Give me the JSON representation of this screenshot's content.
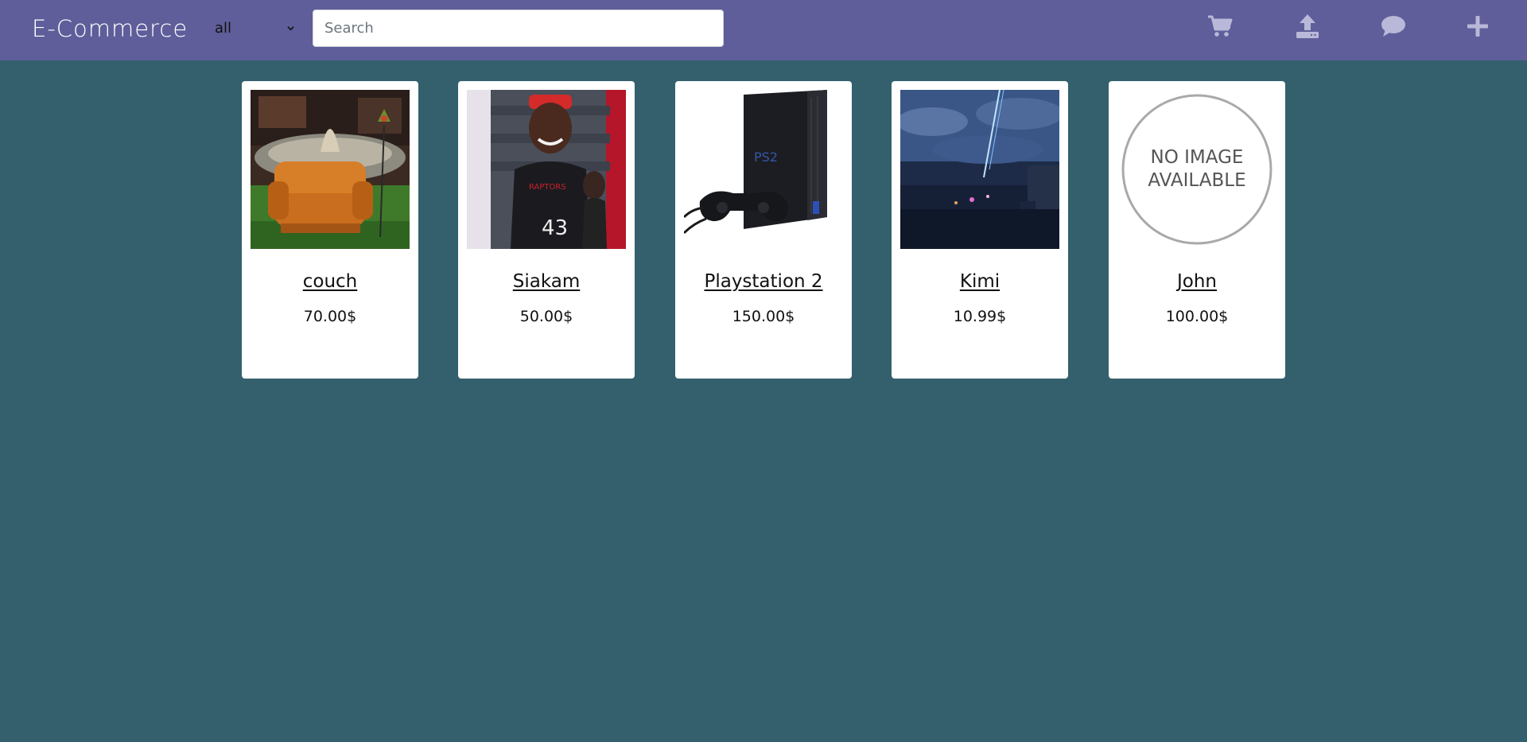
{
  "navbar": {
    "brand": "E-Commerce",
    "category_select": {
      "selected": "all"
    },
    "search": {
      "placeholder": "Search",
      "value": ""
    },
    "icons": [
      "cart-icon",
      "upload-icon",
      "chat-icon",
      "plus-icon"
    ],
    "colors": {
      "background": "#5f5e9a",
      "icon": "#b9b8d8"
    }
  },
  "page": {
    "background": "#33606c"
  },
  "products": [
    {
      "title": "couch",
      "price": "70.00$"
    },
    {
      "title": "Siakam",
      "price": "50.00$"
    },
    {
      "title": "Playstation 2",
      "price": "150.00$"
    },
    {
      "title": "Kimi",
      "price": "10.99$"
    },
    {
      "title": "John",
      "price": "100.00$"
    }
  ],
  "placeholder_image": {
    "line1": "NO IMAGE",
    "line2": "AVAILABLE"
  }
}
